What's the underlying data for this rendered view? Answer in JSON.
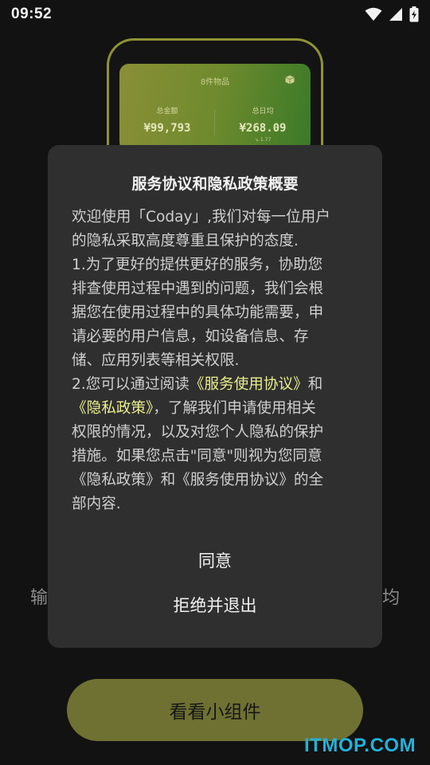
{
  "status_bar": {
    "time": "09:52",
    "icons": [
      "wifi-icon",
      "signal-icon",
      "battery-charging-icon"
    ]
  },
  "background": {
    "widget": {
      "title": "8件物品",
      "total_label": "总金额",
      "total_value": "¥99,793",
      "daily_label": "总日均",
      "daily_value": "¥268.09",
      "daily_sub": "↘ 1.77"
    },
    "left_char": "输",
    "right_char": "均",
    "cta_label": "看看小组件"
  },
  "dialog": {
    "title": "服务协议和隐私政策概要",
    "body": {
      "l1": "欢迎使用「Coday」,我们对每一位用户",
      "l2": "的隐私采取高度尊重且保护的态度.",
      "l3": "1.为了更好的提供更好的服务，协助您",
      "l4": "排查使用过程中遇到的问题，我们会根",
      "l5": "据您在使用过程中的具体功能需要，申",
      "l6": "请必要的用户信息，如设备信息、存",
      "l7": "储、应用列表等相关权限.",
      "l8_a": "2.您可以通过阅读",
      "l8_link": "《服务使用协议》",
      "l8_b": "和",
      "l9_link": "《隐私政策》",
      "l9_b": "，了解我们申请使用相关",
      "l10": "权限的情况，以及对您个人隐私的保护",
      "l11": "措施。如果您点击\"同意\"则视为您同意",
      "l12": "《隐私政策》和《服务使用协议》的全",
      "l13": "部内容."
    },
    "agree_label": "同意",
    "refuse_label": "拒绝并退出"
  },
  "watermark": "ITMOP.COM",
  "colors": {
    "background": "#121212",
    "dialog": "#2f2f2f",
    "link": "#e9ef8e",
    "accent_olive": "#6f7132",
    "phone_frame": "#8f9235",
    "watermark": "#24b0d8"
  }
}
